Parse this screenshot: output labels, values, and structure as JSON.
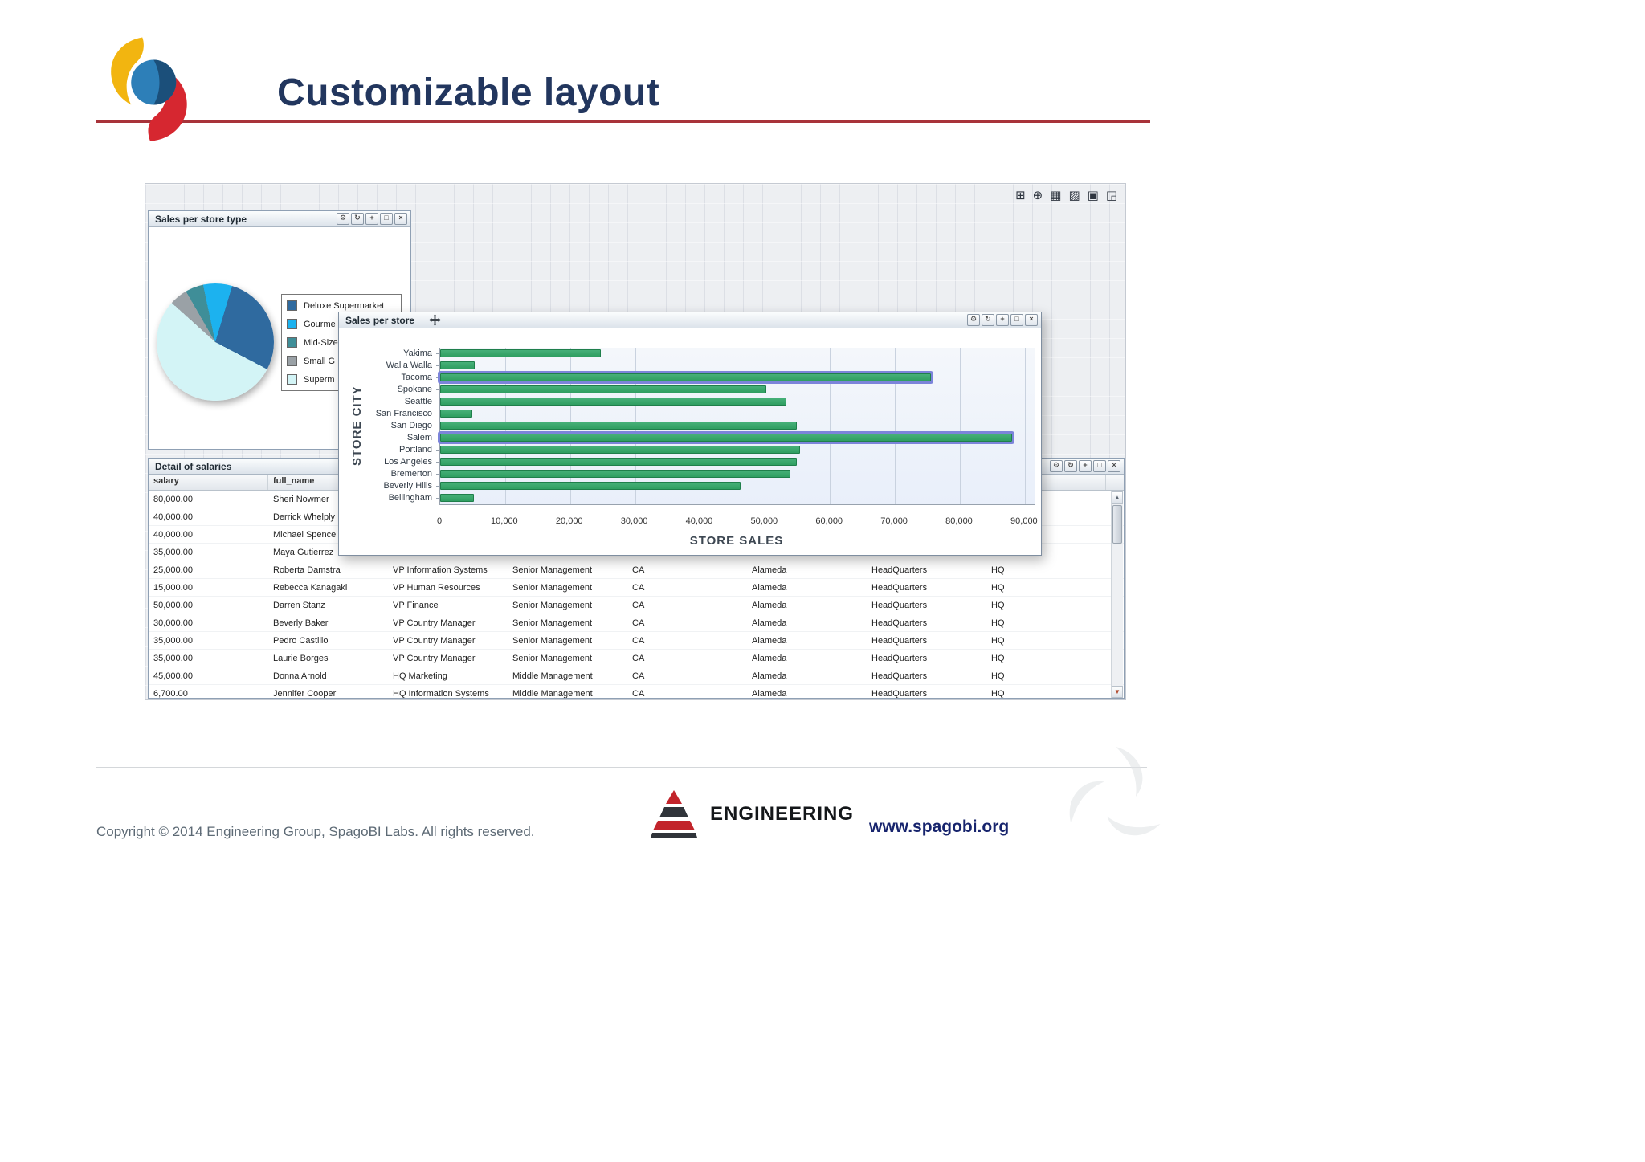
{
  "slide": {
    "title": "Customizable layout",
    "footer": {
      "copyright": "Copyright © 2014 Engineering Group, SpagoBI Labs. All rights reserved.",
      "engineering_label": "ENGINEERING",
      "website": "www.spagobi.org"
    }
  },
  "dashboard": {
    "toolbar_icons": [
      {
        "name": "add-document-icon",
        "glyph": "⊞"
      },
      {
        "name": "move-widget-icon",
        "glyph": "⊕"
      },
      {
        "name": "grid-view-icon",
        "glyph": "▦"
      },
      {
        "name": "edit-table-icon",
        "glyph": "▨"
      },
      {
        "name": "save-icon",
        "glyph": "▣"
      },
      {
        "name": "save-as-icon",
        "glyph": "◲"
      }
    ],
    "window_controls": [
      {
        "name": "settings",
        "glyph": "⚙"
      },
      {
        "name": "refresh",
        "glyph": "↻"
      },
      {
        "name": "add",
        "glyph": "+"
      },
      {
        "name": "maximize",
        "glyph": "□"
      },
      {
        "name": "close",
        "glyph": "×"
      }
    ],
    "pie_panel": {
      "title": "Sales per store type",
      "legend": [
        {
          "label": "Deluxe Supermarket",
          "color": "#2f6a9f"
        },
        {
          "label": "Gourme",
          "color": "#1cb2ef"
        },
        {
          "label": "Mid-Size",
          "color": "#3f8e98"
        },
        {
          "label": "Small G",
          "color": "#9aa1a6"
        },
        {
          "label": "Superm",
          "color": "#d3f4f6"
        }
      ]
    },
    "bar_panel": {
      "title": "Sales per store"
    },
    "table_panel": {
      "title": "Detail of salaries",
      "columns": [
        "salary",
        "full_name",
        "",
        "",
        "",
        "",
        "",
        ""
      ],
      "rows": [
        [
          "80,000.00",
          "Sheri Nowmer",
          "",
          "",
          "",
          "",
          "",
          ""
        ],
        [
          "40,000.00",
          "Derrick Whelply",
          "",
          "",
          "",
          "",
          "",
          ""
        ],
        [
          "40,000.00",
          "Michael Spence",
          "",
          "",
          "",
          "",
          "",
          ""
        ],
        [
          "35,000.00",
          "Maya Gutierrez",
          "",
          "",
          "",
          "",
          "",
          ""
        ],
        [
          "25,000.00",
          "Roberta Damstra",
          "VP Information Systems",
          "Senior Management",
          "CA",
          "Alameda",
          "HeadQuarters",
          "HQ"
        ],
        [
          "15,000.00",
          "Rebecca Kanagaki",
          "VP Human Resources",
          "Senior Management",
          "CA",
          "Alameda",
          "HeadQuarters",
          "HQ"
        ],
        [
          "50,000.00",
          "Darren Stanz",
          "VP Finance",
          "Senior Management",
          "CA",
          "Alameda",
          "HeadQuarters",
          "HQ"
        ],
        [
          "30,000.00",
          "Beverly Baker",
          "VP Country Manager",
          "Senior Management",
          "CA",
          "Alameda",
          "HeadQuarters",
          "HQ"
        ],
        [
          "35,000.00",
          "Pedro Castillo",
          "VP Country Manager",
          "Senior Management",
          "CA",
          "Alameda",
          "HeadQuarters",
          "HQ"
        ],
        [
          "35,000.00",
          "Laurie Borges",
          "VP Country Manager",
          "Senior Management",
          "CA",
          "Alameda",
          "HeadQuarters",
          "HQ"
        ],
        [
          "45,000.00",
          "Donna Arnold",
          "HQ Marketing",
          "Middle Management",
          "CA",
          "Alameda",
          "HeadQuarters",
          "HQ"
        ],
        [
          "6,700.00",
          "Jennifer Cooper",
          "HQ Information Systems",
          "Middle Management",
          "CA",
          "Alameda",
          "HeadQuarters",
          "HQ"
        ]
      ]
    }
  },
  "chart_data": [
    {
      "type": "pie",
      "title": "Sales per store type",
      "labels": [
        "Deluxe Supermarket",
        "Gourme",
        "Mid-Size",
        "Small G",
        "Superm"
      ],
      "values_pct": [
        28,
        8,
        5,
        5,
        54
      ],
      "colors": [
        "#2f6a9f",
        "#1cb2ef",
        "#3f8e98",
        "#9aa1a6",
        "#d3f4f6"
      ],
      "start_angle_deg": -12,
      "clockwise_draw_order": [
        1,
        0,
        4,
        3,
        2
      ],
      "legend_position": "right"
    },
    {
      "type": "bar",
      "orientation": "horizontal",
      "title": "Sales per store",
      "xlabel": "STORE SALES",
      "ylabel": "STORE CITY",
      "categories": [
        "Yakima",
        "Walla Walla",
        "Tacoma",
        "Spokane",
        "Seattle",
        "San Francisco",
        "San Diego",
        "Salem",
        "Portland",
        "Los Angeles",
        "Bremerton",
        "Beverly Hills",
        "Bellingham"
      ],
      "values": [
        24700,
        5300,
        75500,
        50200,
        53300,
        4900,
        54900,
        88000,
        55400,
        54900,
        53900,
        46300,
        5200
      ],
      "highlighted_categories": [
        "Tacoma",
        "Salem"
      ],
      "x_ticks": [
        0,
        10000,
        20000,
        30000,
        40000,
        50000,
        60000,
        70000,
        80000,
        90000
      ],
      "x_tick_labels": [
        "0",
        "10,000",
        "20,000",
        "30,000",
        "40,000",
        "50,000",
        "60,000",
        "70,000",
        "80,000",
        "90,000"
      ],
      "xlim": [
        0,
        91500
      ],
      "grid": true,
      "bar_color": "#2f9e61",
      "highlight_color": "#7c84da"
    }
  ]
}
